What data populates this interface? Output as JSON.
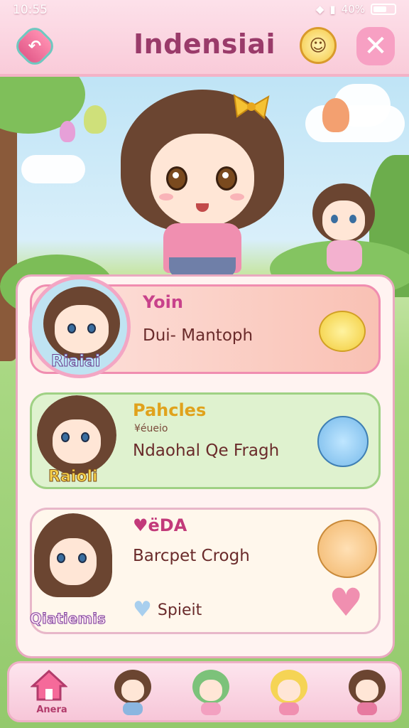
{
  "status": {
    "time": "10:55",
    "right": "40%"
  },
  "header": {
    "title": "Indensiai"
  },
  "icons": {
    "back": "back-arrow-icon",
    "sun": "smiley-sun-icon",
    "close": "close-icon",
    "home": "home-icon",
    "heart": "heart-icon"
  },
  "list": {
    "items": [
      {
        "title": "Yoin",
        "subtitle": "",
        "text": "Dui- Mantoph",
        "name": "Riaiai",
        "accent": "#d04a8a"
      },
      {
        "title": "Pahcles",
        "subtitle": "¥éueio",
        "text": "Ndaohal Qe Fragh",
        "name": "Raioli",
        "accent": "#d48a1a"
      },
      {
        "title": "♥ëDA",
        "subtitle": "",
        "text": "Barcpet Crogh",
        "name": "Qiatiemis",
        "accent": "#c23a7a",
        "extra": "Spieit"
      }
    ]
  },
  "nav": {
    "home_label": "Anera",
    "avatars": [
      "nav-avatar-1",
      "nav-avatar-2",
      "nav-avatar-3",
      "nav-avatar-4"
    ]
  },
  "colors": {
    "accent_pink": "#f08db0",
    "title_purple": "#9a3b6a",
    "card_green": "#dff2cf"
  }
}
